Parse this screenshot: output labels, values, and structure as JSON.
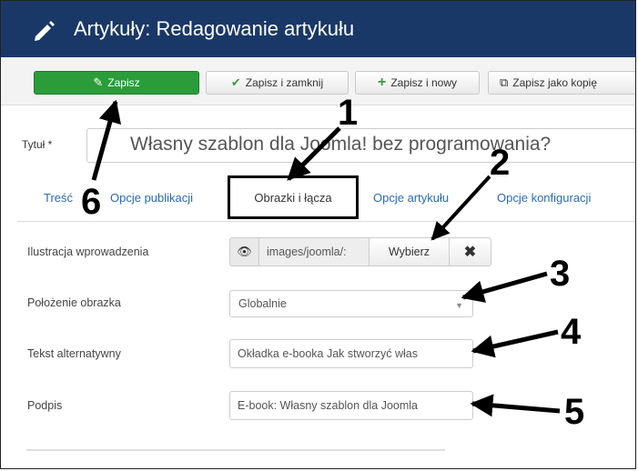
{
  "header": {
    "title": "Artykuły: Redagowanie artykułu",
    "icon": "pencil-icon"
  },
  "toolbar": {
    "save_label": "Zapisz",
    "save_close_label": "Zapisz i zamknij",
    "save_new_label": "Zapisz i nowy",
    "save_copy_label": "Zapisz jako kopię",
    "accent_color": "#2b9c3a"
  },
  "article": {
    "title_label": "Tytuł *",
    "title_value": "Własny szablon dla Joomla! bez programowania?"
  },
  "tabs": [
    {
      "label": "Treść"
    },
    {
      "label": "Opcje publikacji"
    },
    {
      "label": "Obrazki i łącza"
    },
    {
      "label": "Opcje artykułu"
    },
    {
      "label": "Opcje konfiguracji"
    }
  ],
  "images": {
    "intro_label": "Ilustracja wprowadzenia",
    "intro_path": "images/joomla/:",
    "pick_label": "Wybierz",
    "clear_icon": "✖",
    "position_label": "Położenie obrazka",
    "position_value": "Globalnie",
    "alt_label": "Tekst alternatywny",
    "alt_value": "Okładka e-booka Jak stworzyć włas",
    "caption_label": "Podpis",
    "caption_value": "E-book: Własny szablon dla Joomla"
  },
  "annotations": [
    "1",
    "2",
    "3",
    "4",
    "5",
    "6"
  ]
}
